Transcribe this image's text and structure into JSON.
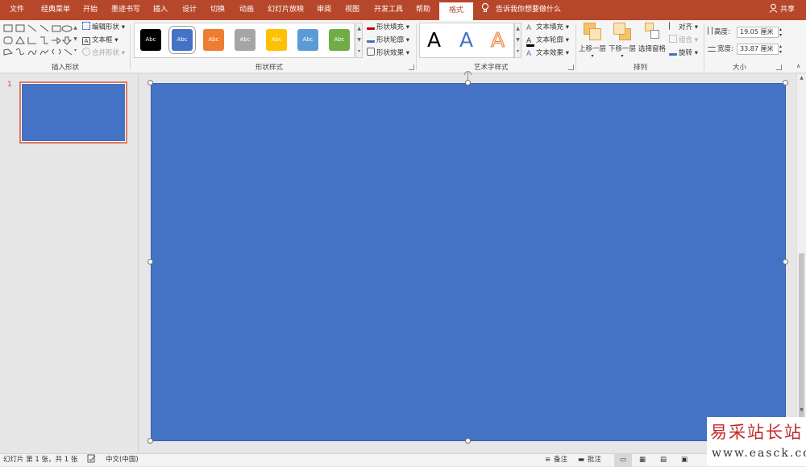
{
  "tabs": [
    "文件",
    "经典菜单",
    "开始",
    "墨迹书写",
    "插入",
    "设计",
    "切换",
    "动画",
    "幻灯片放映",
    "审阅",
    "视图",
    "开发工具",
    "帮助",
    "格式"
  ],
  "active_tab": "格式",
  "tell_me": "告诉我你想要做什么",
  "share": "共享",
  "ribbon": {
    "insert_shapes": {
      "label": "插入形状",
      "edit_shape": "编辑形状",
      "text_box": "文本框",
      "merge_shapes": "合并形状"
    },
    "shape_styles": {
      "label": "形状样式",
      "swatches": [
        {
          "text": "Abc",
          "color": "#000000"
        },
        {
          "text": "Abc",
          "color": "#4472c4"
        },
        {
          "text": "Abc",
          "color": "#ed7d31"
        },
        {
          "text": "Abc",
          "color": "#a5a5a5"
        },
        {
          "text": "Abc",
          "color": "#ffc000"
        },
        {
          "text": "Abc",
          "color": "#5b9bd5"
        },
        {
          "text": "Abc",
          "color": "#70ad47"
        }
      ],
      "fill": "形状填充",
      "outline": "形状轮廓",
      "effects": "形状效果"
    },
    "wordart": {
      "label": "艺术字样式",
      "samples": [
        "A",
        "A",
        "A"
      ],
      "text_fill": "文本填充",
      "text_outline": "文本轮廓",
      "text_effects": "文本效果"
    },
    "arrange": {
      "label": "排列",
      "bring_forward": "上移一层",
      "send_backward": "下移一层",
      "selection_pane": "选择窗格",
      "align": "对齐",
      "group": "组合",
      "rotate": "旋转"
    },
    "size": {
      "label": "大小",
      "height_label": "高度:",
      "height_value": "19.05 厘米",
      "width_label": "宽度:",
      "width_value": "33.87 厘米"
    }
  },
  "slides_panel": {
    "slide_number": "1"
  },
  "slide": {
    "color": "#4472c4"
  },
  "status": {
    "slide_info": "幻灯片 第 1 张，共 1 张",
    "language": "中文(中国)",
    "notes": "备注",
    "comments": "批注"
  },
  "watermark": {
    "line1": "易采站长站",
    "line2": "www.easck.com"
  }
}
